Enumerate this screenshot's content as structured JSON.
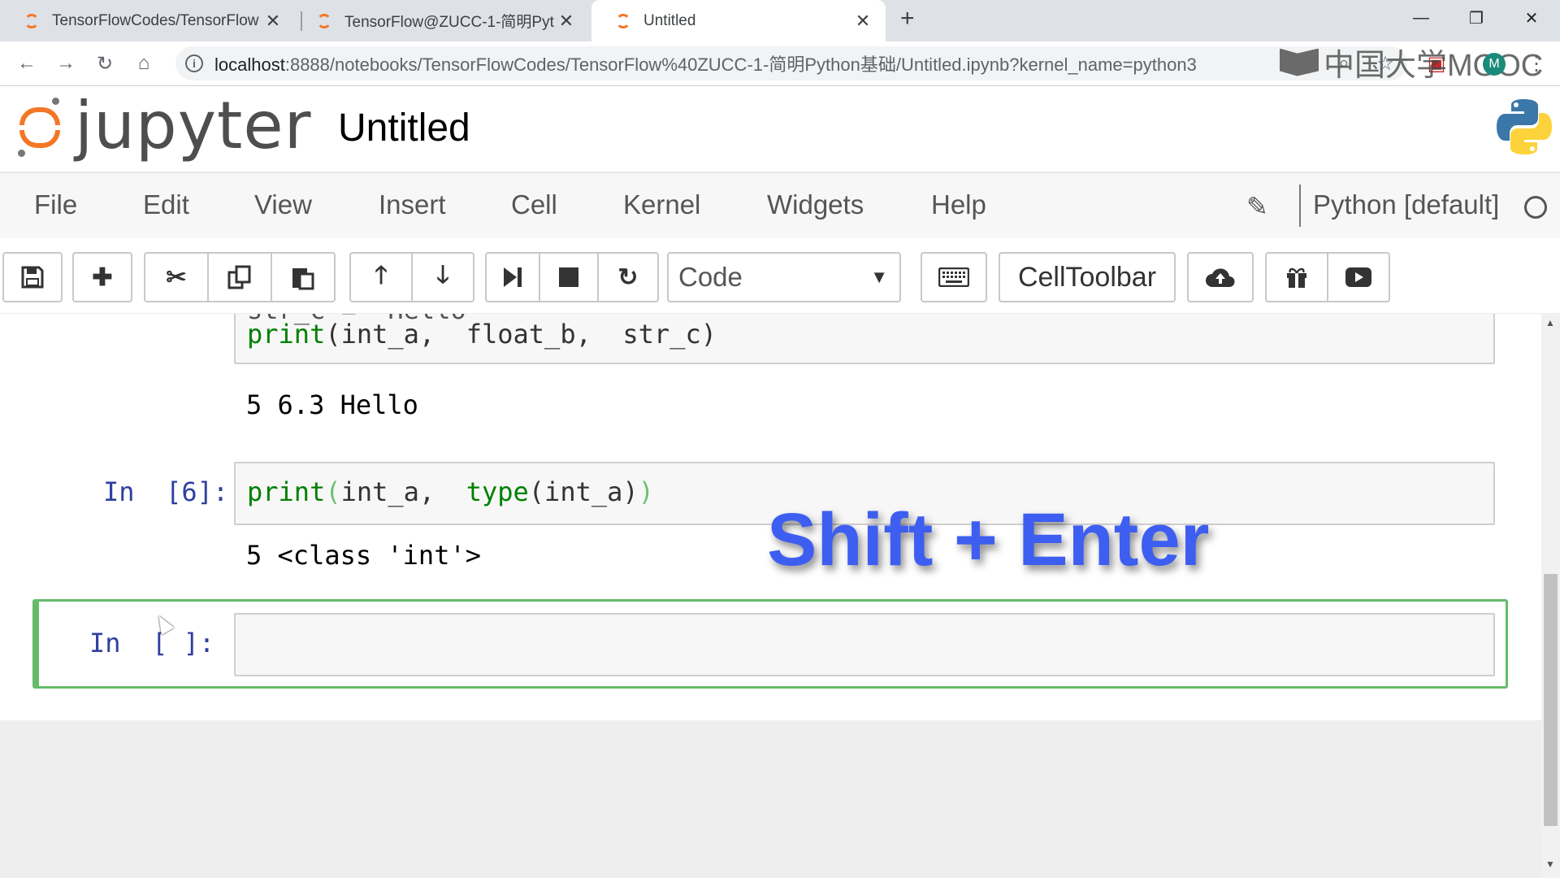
{
  "browser": {
    "tabs": [
      {
        "title": "TensorFlowCodes/TensorFlow",
        "active": false
      },
      {
        "title": "TensorFlow@ZUCC-1-简明Pyt",
        "active": false
      },
      {
        "title": "Untitled",
        "active": true
      }
    ],
    "url_host": "localhost",
    "url_path": ":8888/notebooks/TensorFlowCodes/TensorFlow%40ZUCC-1-简明Python基础/Untitled.ipynb?kernel_name=python3",
    "watermark": "中国大学MOOC",
    "avatar_letter": "M"
  },
  "jupyter": {
    "logo_text": "jupyter",
    "notebook_name": "Untitled",
    "menu": [
      "File",
      "Edit",
      "View",
      "Insert",
      "Cell",
      "Kernel",
      "Widgets",
      "Help"
    ],
    "kernel_name": "Python [default]",
    "cell_type": "Code",
    "celltoolbar_label": "CellToolbar"
  },
  "cells": [
    {
      "prompt": "",
      "lines_partial": "str_c = \"Hello\"",
      "line": {
        "fn": "print",
        "args": "(int_a,  float_b,  str_c)"
      },
      "output": "5 6.3 Hello"
    },
    {
      "prompt": "In  [6]:",
      "line": {
        "fn": "print",
        "open": "(",
        "arg1": "int_a,  ",
        "fn2": "type",
        "rest": "(int_a)",
        "close": ")"
      },
      "output": "5 <class 'int'>"
    },
    {
      "prompt": "In  [ ]:",
      "line": ""
    }
  ],
  "overlay_text": "Shift + Enter",
  "colors": {
    "accent": "#f37726",
    "selected_cell": "#66bb6a",
    "prompt": "#303f9f",
    "overlay": "#3d5ef0"
  }
}
